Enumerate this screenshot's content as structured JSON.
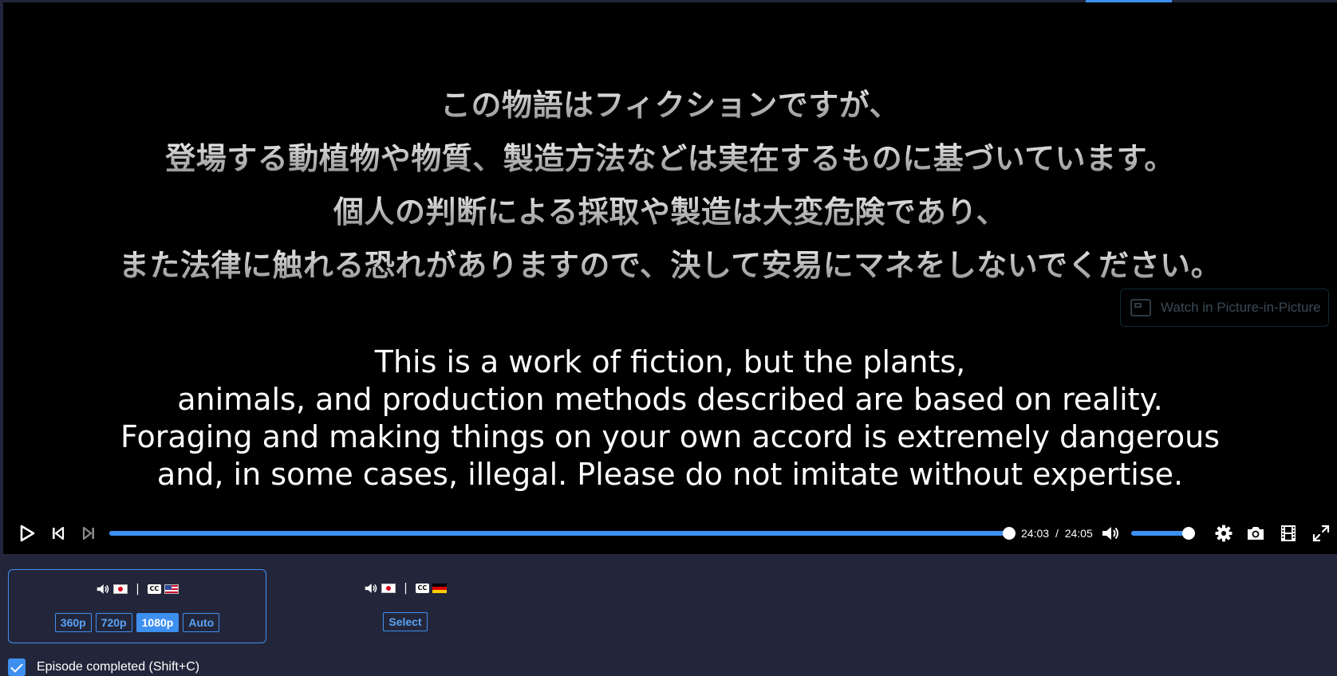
{
  "player": {
    "subtitles_jp": [
      "この物語はフィクションですが、",
      "登場する動植物や物質、製造方法などは実在するものに基づいています。",
      "個人の判断による採取や製造は大変危険であり、",
      "また法律に触れる恐れがありますので、決して安易にマネをしないでください。"
    ],
    "subtitles_en": [
      "This is a work of fiction, but the plants,",
      "animals, and production methods described are based on reality.",
      "Foraging and making things on your own accord is extremely dangerous",
      "and, in some cases, illegal. Please do not imitate without expertise."
    ],
    "pip_label": "Watch in Picture-in-Picture",
    "time_current": "24:03",
    "time_separator": "/",
    "time_total": "24:05",
    "progress": 0.9986,
    "volume": 0.9
  },
  "sources": [
    {
      "audio_flag": "flag-jp",
      "sub_flag": "flag-us",
      "selected": true,
      "qualities": [
        "360p",
        "720p",
        "1080p",
        "Auto"
      ],
      "active_quality": "1080p"
    },
    {
      "audio_flag": "flag-jp",
      "sub_flag": "flag-de",
      "selected": false,
      "select_label": "Select"
    }
  ],
  "episode": {
    "completed_label": "Episode completed (Shift+C)",
    "completed": true
  },
  "colors": {
    "accent": "#3d8ff0",
    "page_bg": "#23263a",
    "player_bg": "#000000"
  }
}
